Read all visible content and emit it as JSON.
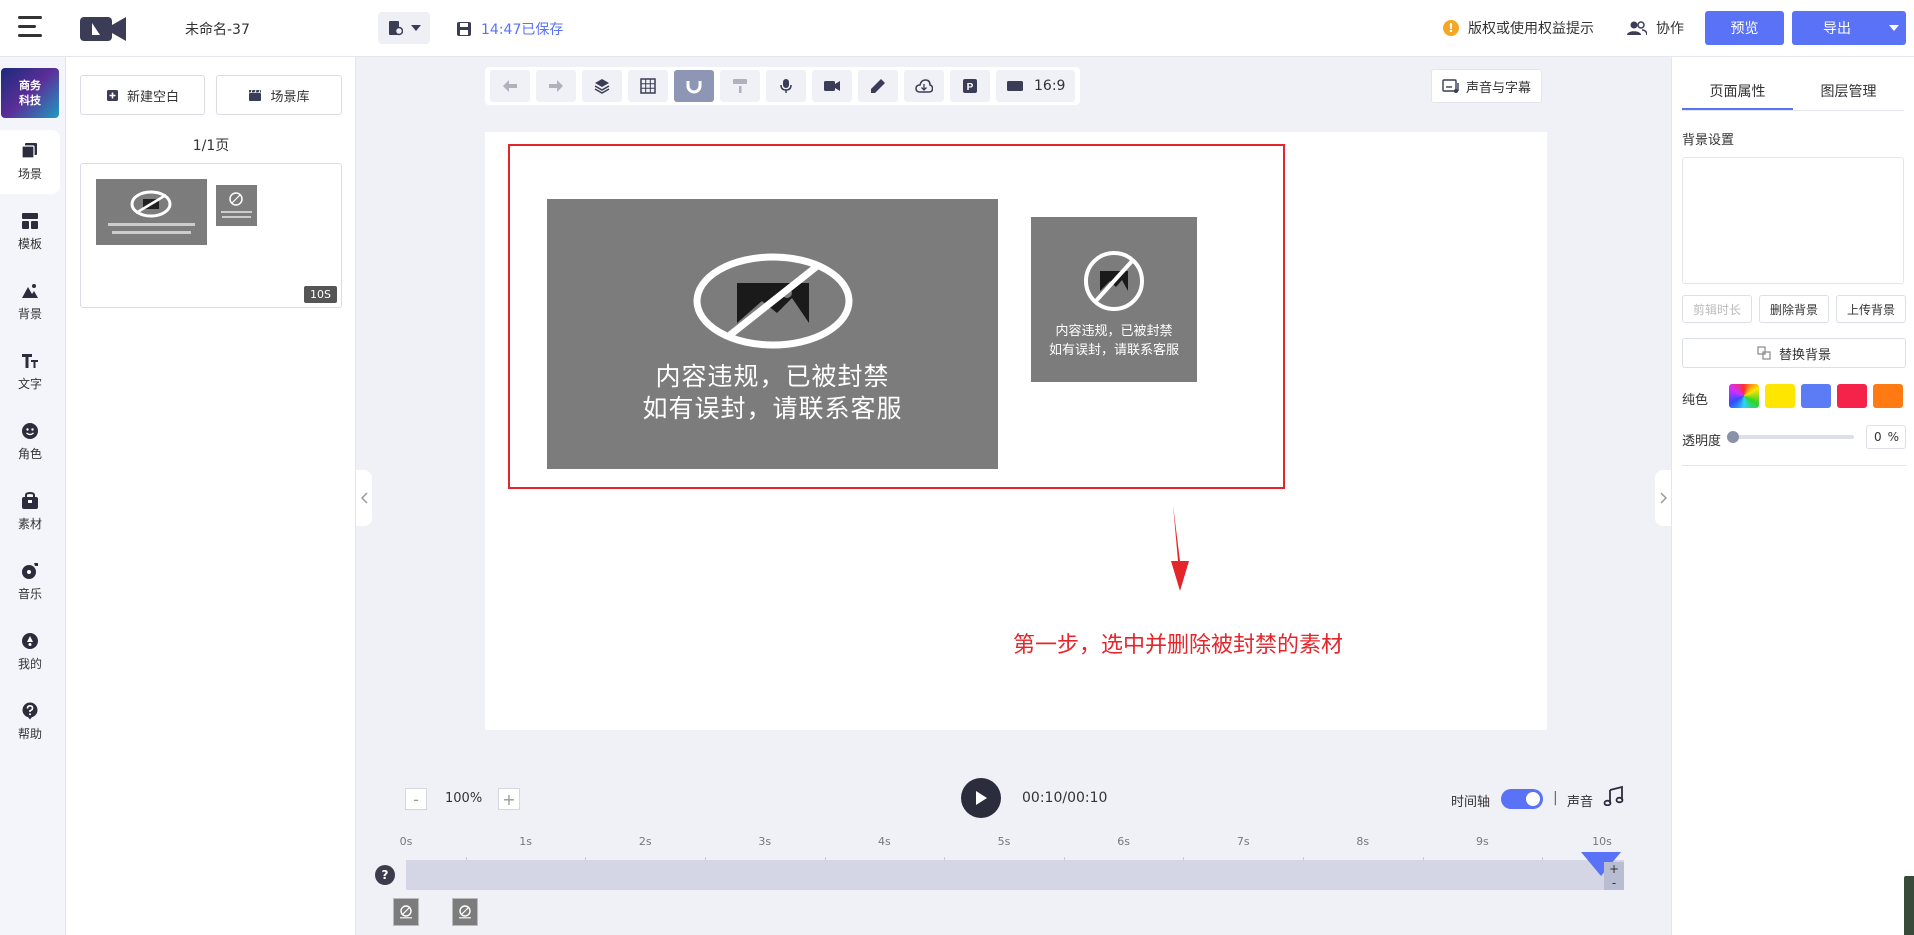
{
  "header": {
    "doc_title": "未命名-37",
    "saved_status": "14:47已保存",
    "copyright_notice": "版权或使用权益提示",
    "collab_label": "协作",
    "preview_label": "预览",
    "export_label": "导出"
  },
  "leftnav": {
    "brand_text": "商务\n科技",
    "items": [
      {
        "label": "场景",
        "icon": "scene-icon"
      },
      {
        "label": "模板",
        "icon": "template-icon"
      },
      {
        "label": "背景",
        "icon": "background-icon"
      },
      {
        "label": "文字",
        "icon": "text-icon"
      },
      {
        "label": "角色",
        "icon": "character-icon"
      },
      {
        "label": "素材",
        "icon": "material-icon"
      },
      {
        "label": "音乐",
        "icon": "music-icon"
      },
      {
        "label": "我的",
        "icon": "mine-icon"
      },
      {
        "label": "帮助",
        "icon": "help-icon"
      }
    ]
  },
  "scenes": {
    "new_blank_label": "新建空白",
    "library_label": "场景库",
    "page_count": "1/1页",
    "scene_duration": "10S"
  },
  "toolbar": {
    "aspect_ratio": "16:9",
    "audio_subtitle_label": "声音与字幕"
  },
  "canvas": {
    "banned_line1": "内容违规，已被封禁",
    "banned_line2": "如有误封，请联系客服",
    "annotation": "第一步，选中并删除被封禁的素材",
    "annotation_color": "#e5252c"
  },
  "timeline": {
    "zoom": "100%",
    "time": "00:10/00:10",
    "timeline_toggle_label": "时间轴",
    "separator": "|",
    "sound_label": "声音",
    "ticks": [
      "0s",
      "1s",
      "2s",
      "3s",
      "4s",
      "5s",
      "6s",
      "7s",
      "8s",
      "9s",
      "10s"
    ],
    "help_symbol": "?",
    "plus": "+",
    "minus": "-"
  },
  "rightpanel": {
    "tab_page": "页面属性",
    "tab_layers": "图层管理",
    "bg_section": "背景设置",
    "btn_trim": "剪辑时长",
    "btn_delete_bg": "删除背景",
    "btn_upload_bg": "上传背景",
    "btn_replace_bg": "替换背景",
    "solid_color_label": "纯色",
    "swatches": [
      "rainbow",
      "#ffe600",
      "#5b7cf5",
      "#f5234a",
      "#ff7a13"
    ],
    "opacity_label": "透明度",
    "opacity_value": "0",
    "opacity_unit": "%"
  },
  "colors": {
    "accent": "#5a72f5",
    "banned_bg": "#7c7c7c"
  }
}
